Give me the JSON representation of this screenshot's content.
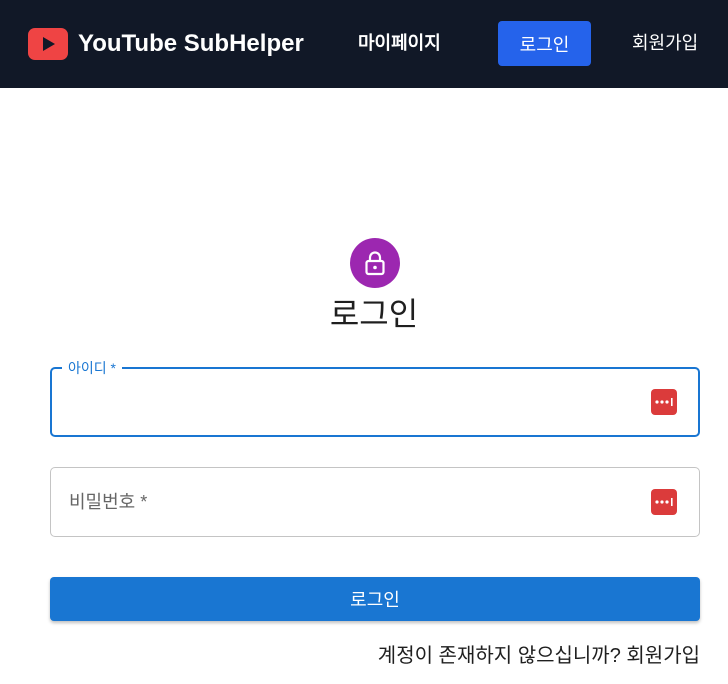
{
  "navbar": {
    "brand": "YouTube SubHelper",
    "brand_icon": "youtube-play-icon",
    "mypage_label": "마이페이지",
    "login_label": "로그인",
    "signup_label": "회원가입",
    "background_color": "#111827",
    "login_button_color": "#2563eb"
  },
  "form": {
    "icon": "lock-icon",
    "icon_color": "#9c27b0",
    "title": "로그인",
    "id_field": {
      "label": "아이디 *",
      "value": ""
    },
    "password_field": {
      "label": "비밀번호 *",
      "value": ""
    },
    "password_manager_icon": "password-manager-icon",
    "submit_label": "로그인",
    "submit_color": "#1976d2",
    "signup_prompt": "계정이 존재하지 않으십니까? 회원가입"
  }
}
